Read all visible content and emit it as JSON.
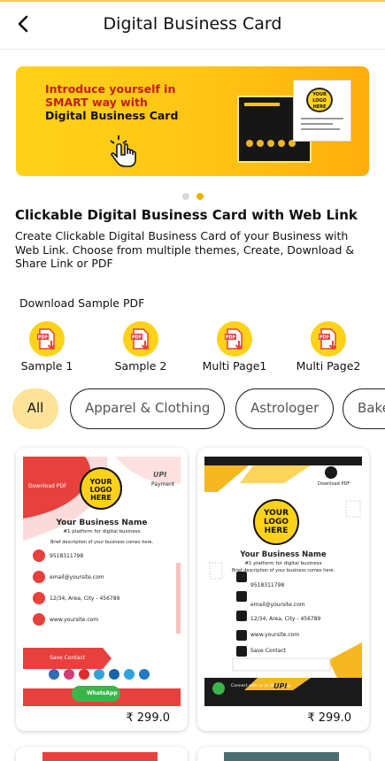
{
  "header": {
    "title": "Digital Business Card",
    "back_icon": "arrow-left-icon"
  },
  "banner": {
    "line1": "Introduce yourself in",
    "line2": "SMART way with",
    "line3": "Digital Business Card",
    "logo_text": "YOUR LOGO HERE",
    "slides": 2,
    "active_slide": 2
  },
  "intro": {
    "title": "Clickable Digital Business Card with Web Link",
    "description": "Create Clickable Digital Business Card of your Business with Web Link. Choose from multiple themes, Create, Download & Share Link or PDF"
  },
  "samples": {
    "title": "Download Sample PDF",
    "items": [
      {
        "label": "Sample 1",
        "icon": "pdf-download-icon"
      },
      {
        "label": "Sample 2",
        "icon": "pdf-download-icon"
      },
      {
        "label": "Multi Page1",
        "icon": "pdf-download-icon"
      },
      {
        "label": "Multi Page2",
        "icon": "pdf-download-icon"
      }
    ]
  },
  "categories": [
    {
      "label": "All",
      "active": true
    },
    {
      "label": "Apparel & Clothing",
      "active": false
    },
    {
      "label": "Astrologer",
      "active": false
    },
    {
      "label": "Bake",
      "active": false
    }
  ],
  "cards": [
    {
      "price": "₹ 299.0",
      "download": "Download PDF",
      "payment": "Payment",
      "brand": "UPI",
      "logo": "YOUR LOGO HERE",
      "name": "Your Business Name",
      "tagline": "#1 platform for digital business",
      "brief": "Brief description of your business comes here.",
      "phone": "9518311798",
      "email": "email@yoursite.com",
      "address": "12/34, Area, City - 456789",
      "website": "www.yoursite.com",
      "save": "Save Contact",
      "whatsapp": "WhatsApp"
    },
    {
      "price": "₹ 299.0",
      "download": "Download PDF",
      "brand": "UPI",
      "logo": "YOUR LOGO HERE",
      "name": "Your Business Name",
      "tagline": "#1 platform for digital business",
      "brief": "Brief description of your business comes here.",
      "phone": "9518311798",
      "email": "email@yoursite.com",
      "address": "12/34, Area, City - 456789",
      "website": "www.yoursite.com",
      "save": "Save Contact",
      "whatsapp": "Connect with us on WhatsApp"
    }
  ],
  "colors": {
    "accent": "#ffd21a",
    "red": "#e8403d",
    "chip_active": "#fde39a"
  }
}
